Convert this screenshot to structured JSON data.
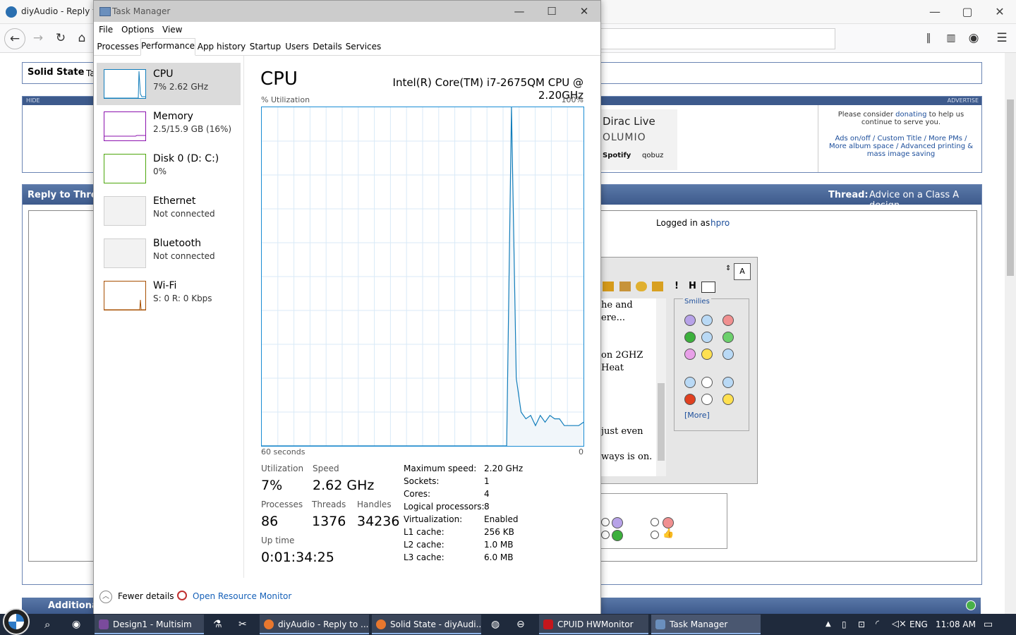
{
  "browser": {
    "title": "diyAudio - Reply to",
    "controls": {
      "minimize": "—",
      "maximize": "▢",
      "close": "✕"
    },
    "page": {
      "forum_title_prefix": "Solid State",
      "forum_title_suffix": "Ta",
      "hide_label": "HIDE",
      "advertise_label": "ADVERTISE",
      "ad_lines": [
        "Dirac Live",
        "OLUMIO",
        "Spotify",
        "qobuz"
      ],
      "donate_text_1": "Please consider",
      "donate_link": "donating",
      "donate_text_2": "to help us continue to serve you.",
      "options_links": "Ads on/off / Custom Title / More PMs / More album space / Advanced printing & mass image saving",
      "reply_header": "Reply to Thre",
      "thread_label": "Thread:",
      "thread_title": "Advice on a Class A design",
      "logged_in_prefix": "Logged in as",
      "logged_in_user": "hpro",
      "editor_snippets": [
        "he and",
        "ere...",
        "on 2GHZ",
        "Heat",
        "just even",
        "ways is on."
      ],
      "smilies_title": "Smilies",
      "smilies_more": "[More]",
      "additional_options": "Additional Op"
    }
  },
  "taskmanager": {
    "title": "Task Manager",
    "controls": {
      "minimize": "—",
      "maximize": "☐",
      "close": "✕"
    },
    "menu": [
      "File",
      "Options",
      "View"
    ],
    "tabs": [
      "Processes",
      "Performance",
      "App history",
      "Startup",
      "Users",
      "Details",
      "Services"
    ],
    "active_tab": "Performance",
    "resources": [
      {
        "name": "CPU",
        "sub": "7% 2.62 GHz",
        "color": "#117dbb"
      },
      {
        "name": "Memory",
        "sub": "2.5/15.9 GB (16%)",
        "color": "#8b12ae"
      },
      {
        "name": "Disk 0 (D: C:)",
        "sub": "0%",
        "color": "#4da60c"
      },
      {
        "name": "Ethernet",
        "sub": "Not connected",
        "color": "#a7a7a7"
      },
      {
        "name": "Bluetooth",
        "sub": "Not connected",
        "color": "#a7a7a7"
      },
      {
        "name": "Wi-Fi",
        "sub": "S: 0 R: 0 Kbps",
        "color": "#a74f01"
      }
    ],
    "cpu": {
      "title": "CPU",
      "model": "Intel(R) Core(TM) i7-2675QM CPU @ 2.20GHz",
      "util_label": "% Utilization",
      "util_max": "100%",
      "time_left": "60 seconds",
      "time_right": "0",
      "graph_color": "#117dbb",
      "graph_fill": "#f1f6fa",
      "utilization_history_pct": [
        0,
        0,
        0,
        0,
        0,
        0,
        0,
        0,
        0,
        0,
        0,
        0,
        0,
        0,
        0,
        0,
        0,
        0,
        0,
        0,
        0,
        0,
        0,
        0,
        0,
        0,
        0,
        0,
        0,
        0,
        0,
        0,
        0,
        0,
        0,
        0,
        0,
        0,
        0,
        0,
        0,
        0,
        0,
        0,
        0,
        0,
        0,
        0,
        0,
        0,
        0,
        0,
        100,
        20,
        10,
        8,
        9,
        6,
        9,
        7,
        9,
        8,
        8,
        6,
        6,
        6,
        6,
        7
      ],
      "stats": {
        "utilization_label": "Utilization",
        "utilization": "7%",
        "speed_label": "Speed",
        "speed": "2.62 GHz",
        "processes_label": "Processes",
        "processes": "86",
        "threads_label": "Threads",
        "threads": "1376",
        "handles_label": "Handles",
        "handles": "34236",
        "uptime_label": "Up time",
        "uptime": "0:01:34:25"
      },
      "specs": [
        {
          "label": "Maximum speed:",
          "value": "2.20 GHz"
        },
        {
          "label": "Sockets:",
          "value": "1"
        },
        {
          "label": "Cores:",
          "value": "4"
        },
        {
          "label": "Logical processors:",
          "value": "8"
        },
        {
          "label": "Virtualization:",
          "value": "Enabled"
        },
        {
          "label": "L1 cache:",
          "value": "256 KB"
        },
        {
          "label": "L2 cache:",
          "value": "1.0 MB"
        },
        {
          "label": "L3 cache:",
          "value": "6.0 MB"
        }
      ]
    },
    "footer": {
      "fewer_details": "Fewer details",
      "open_resource_monitor": "Open Resource Monitor"
    }
  },
  "taskbar": {
    "apps": [
      {
        "label": "Design1 - Multisim",
        "color": "#7a4b9c"
      },
      {
        "label": "diyAudio - Reply to ...",
        "color": "#e8772e"
      },
      {
        "label": "Solid State - diyAudi...",
        "color": "#e8772e"
      },
      {
        "label": "CPUID HWMonitor",
        "color": "#c4161c"
      },
      {
        "label": "Task Manager",
        "color": "#6a8fbd"
      }
    ],
    "language": "ENG",
    "time": "11:08 AM"
  }
}
